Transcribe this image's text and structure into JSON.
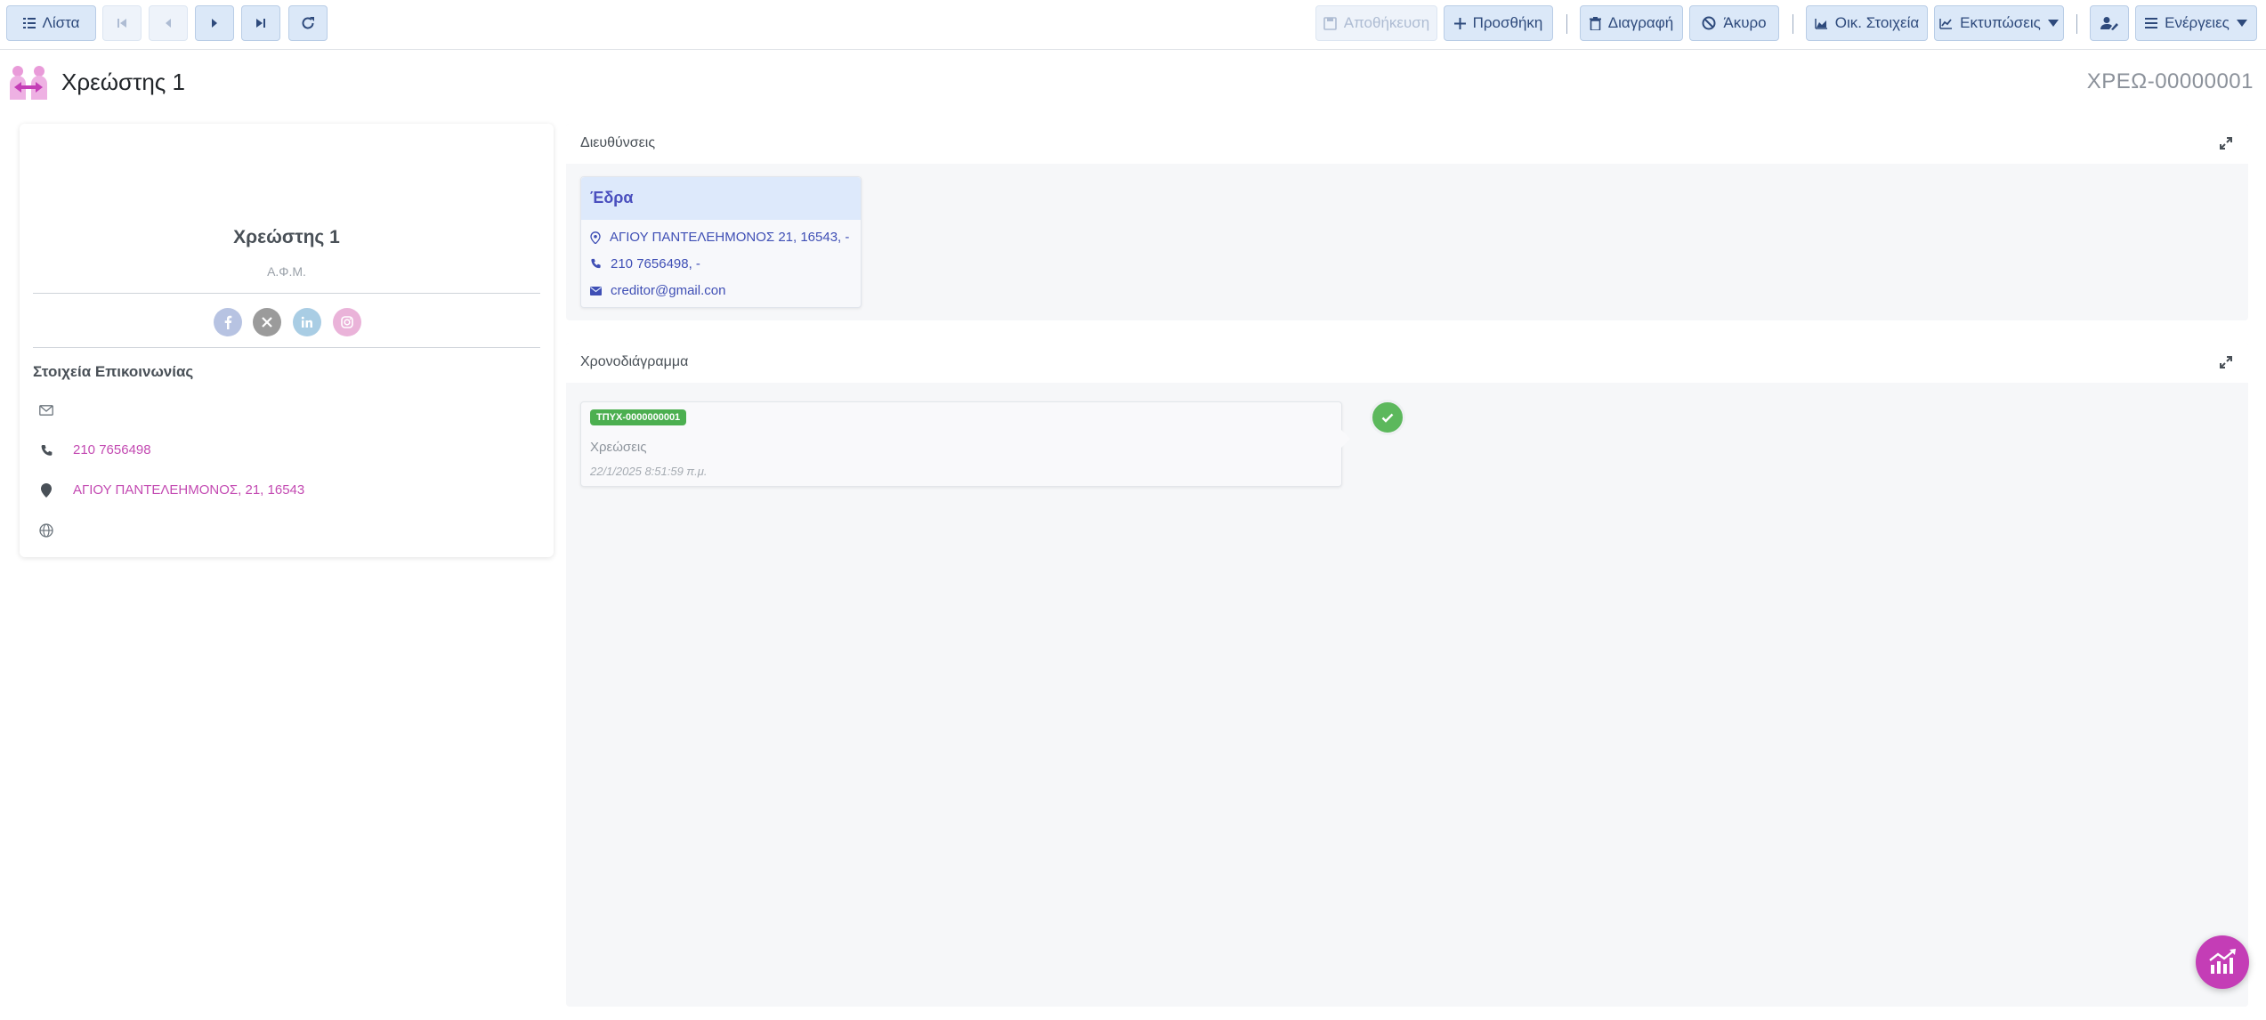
{
  "toolbar": {
    "list_label": "Λίστα",
    "save_label": "Αποθήκευση",
    "add_label": "Προσθήκη",
    "delete_label": "Διαγραφή",
    "cancel_label": "Άκυρο",
    "financial_label": "Οικ. Στοιχεία",
    "prints_label": "Εκτυπώσεις",
    "actions_label": "Ενέργειες"
  },
  "header": {
    "title": "Χρεώστης 1",
    "code": "ΧΡΕΩ-00000001"
  },
  "profile": {
    "name": "Χρεώστης 1",
    "afm_label": "Α.Φ.Μ.",
    "social": [
      "facebook-icon",
      "x-icon",
      "linkedin-icon",
      "instagram-icon"
    ],
    "contact_title": "Στοιχεία Επικοινωνίας",
    "email": "",
    "phone": "210 7656498",
    "address": "ΑΓΙΟΥ ΠΑΝΤΕΛΕΗΜΟΝΟΣ, 21, 16543",
    "website": ""
  },
  "addresses": {
    "title": "Διευθύνσεις",
    "items": [
      {
        "label": "Έδρα",
        "address": "ΑΓΙΟΥ ΠΑΝΤΕΛΕΗΜΟΝΟΣ 21, 16543, -",
        "phone": "210 7656498, -",
        "email": "creditor@gmail.con"
      }
    ]
  },
  "timeline": {
    "title": "Χρονοδιάγραμμα",
    "events": [
      {
        "badge": "ΤΠΥΧ-0000000001",
        "description": "Χρεώσεις",
        "date": "22/1/2025 8:51:59 π.μ.",
        "status": "completed"
      }
    ]
  },
  "colors": {
    "accent": "#c43db6",
    "toolbar_button": "#dbe8f8",
    "success": "#4caf50",
    "link": "#3f4fb5"
  }
}
